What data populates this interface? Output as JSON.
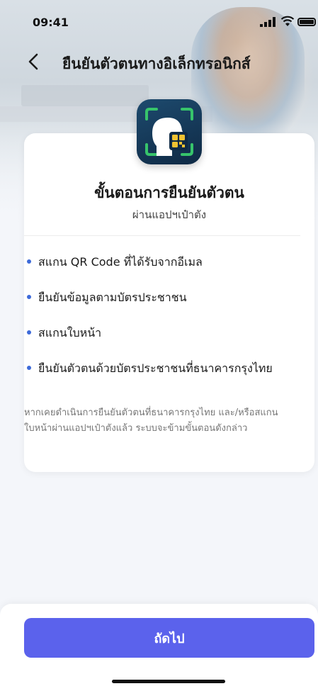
{
  "status_bar": {
    "time": "09:41",
    "icons": [
      "signal-icon",
      "wifi-icon",
      "battery-icon"
    ]
  },
  "nav": {
    "title": "ยืนยันตัวตนทางอิเล็กทรอนิกส์",
    "back_icon": "chevron-left-icon"
  },
  "card": {
    "icon": "face-scan-qr-icon",
    "heading": "ขั้นตอนการยืนยันตัวตน",
    "subheading": "ผ่านแอปฯเป๋าตัง",
    "steps": [
      "สแกน QR Code ที่ได้รับจากอีเมล",
      "ยืนยันข้อมูลตามบัตรประชาชน",
      "สแกนใบหน้า",
      "ยืนยันตัวตนด้วยบัตรประชาชนที่ธนาคารกรุงไทย"
    ],
    "note": "หากเคยดำเนินการยืนยันตัวตนที่ธนาคารกรุงไทย และ/หรือสแกนใบหน้าผ่านแอปฯเป๋าตังแล้ว ระบบจะข้ามขั้นตอนดังกล่าว"
  },
  "footer": {
    "next_label": "ถัดไป"
  },
  "colors": {
    "accent": "#5b62ec",
    "bullet": "#3d6ad9",
    "icon_bg": "#1d4a6e"
  }
}
